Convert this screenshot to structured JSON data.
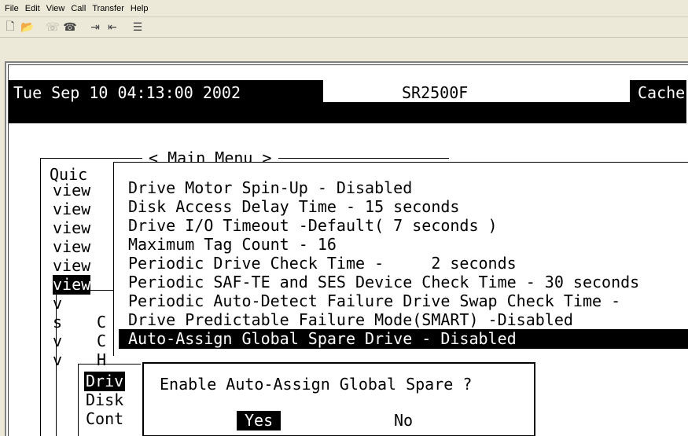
{
  "menubar": [
    "File",
    "Edit",
    "View",
    "Call",
    "Transfer",
    "Help"
  ],
  "toolbar": [
    "new-icon",
    "open-icon",
    "disconnect-icon",
    "connect-icon",
    "send-icon",
    "receive-icon",
    "properties-icon"
  ],
  "terminal": {
    "datetime": "Tue Sep 10 04:13:00 2002",
    "model": "SR2500F",
    "cache": "Cache",
    "main_menu_title": "< Main Menu >",
    "left_items": [
      "Quic",
      "view",
      "view",
      "view",
      "view",
      "view",
      "view",
      "v",
      "s",
      "v",
      "v"
    ],
    "left_selected_index": 6,
    "left_sub": [
      "C",
      "C",
      "H"
    ],
    "submenu": [
      "Drive Motor Spin-Up - Disabled",
      "Disk Access Delay Time - 15 seconds",
      "Drive I/O Timeout -Default( 7 seconds )",
      "Maximum Tag Count - 16",
      "Periodic Drive Check Time -     2 seconds",
      "Periodic SAF-TE and SES Device Check Time - 30 seconds",
      "Periodic Auto-Detect Failure Drive Swap Check Time -",
      "Drive Predictable Failure Mode(SMART) -Disabled",
      "Auto-Assign Global Spare Drive - Disabled"
    ],
    "submenu_selected_index": 8,
    "lower_items": [
      "Driv",
      "Disk",
      "Cont"
    ],
    "dialog": {
      "question": "Enable Auto-Assign Global Spare ?",
      "yes": "Yes",
      "no": "No"
    }
  }
}
